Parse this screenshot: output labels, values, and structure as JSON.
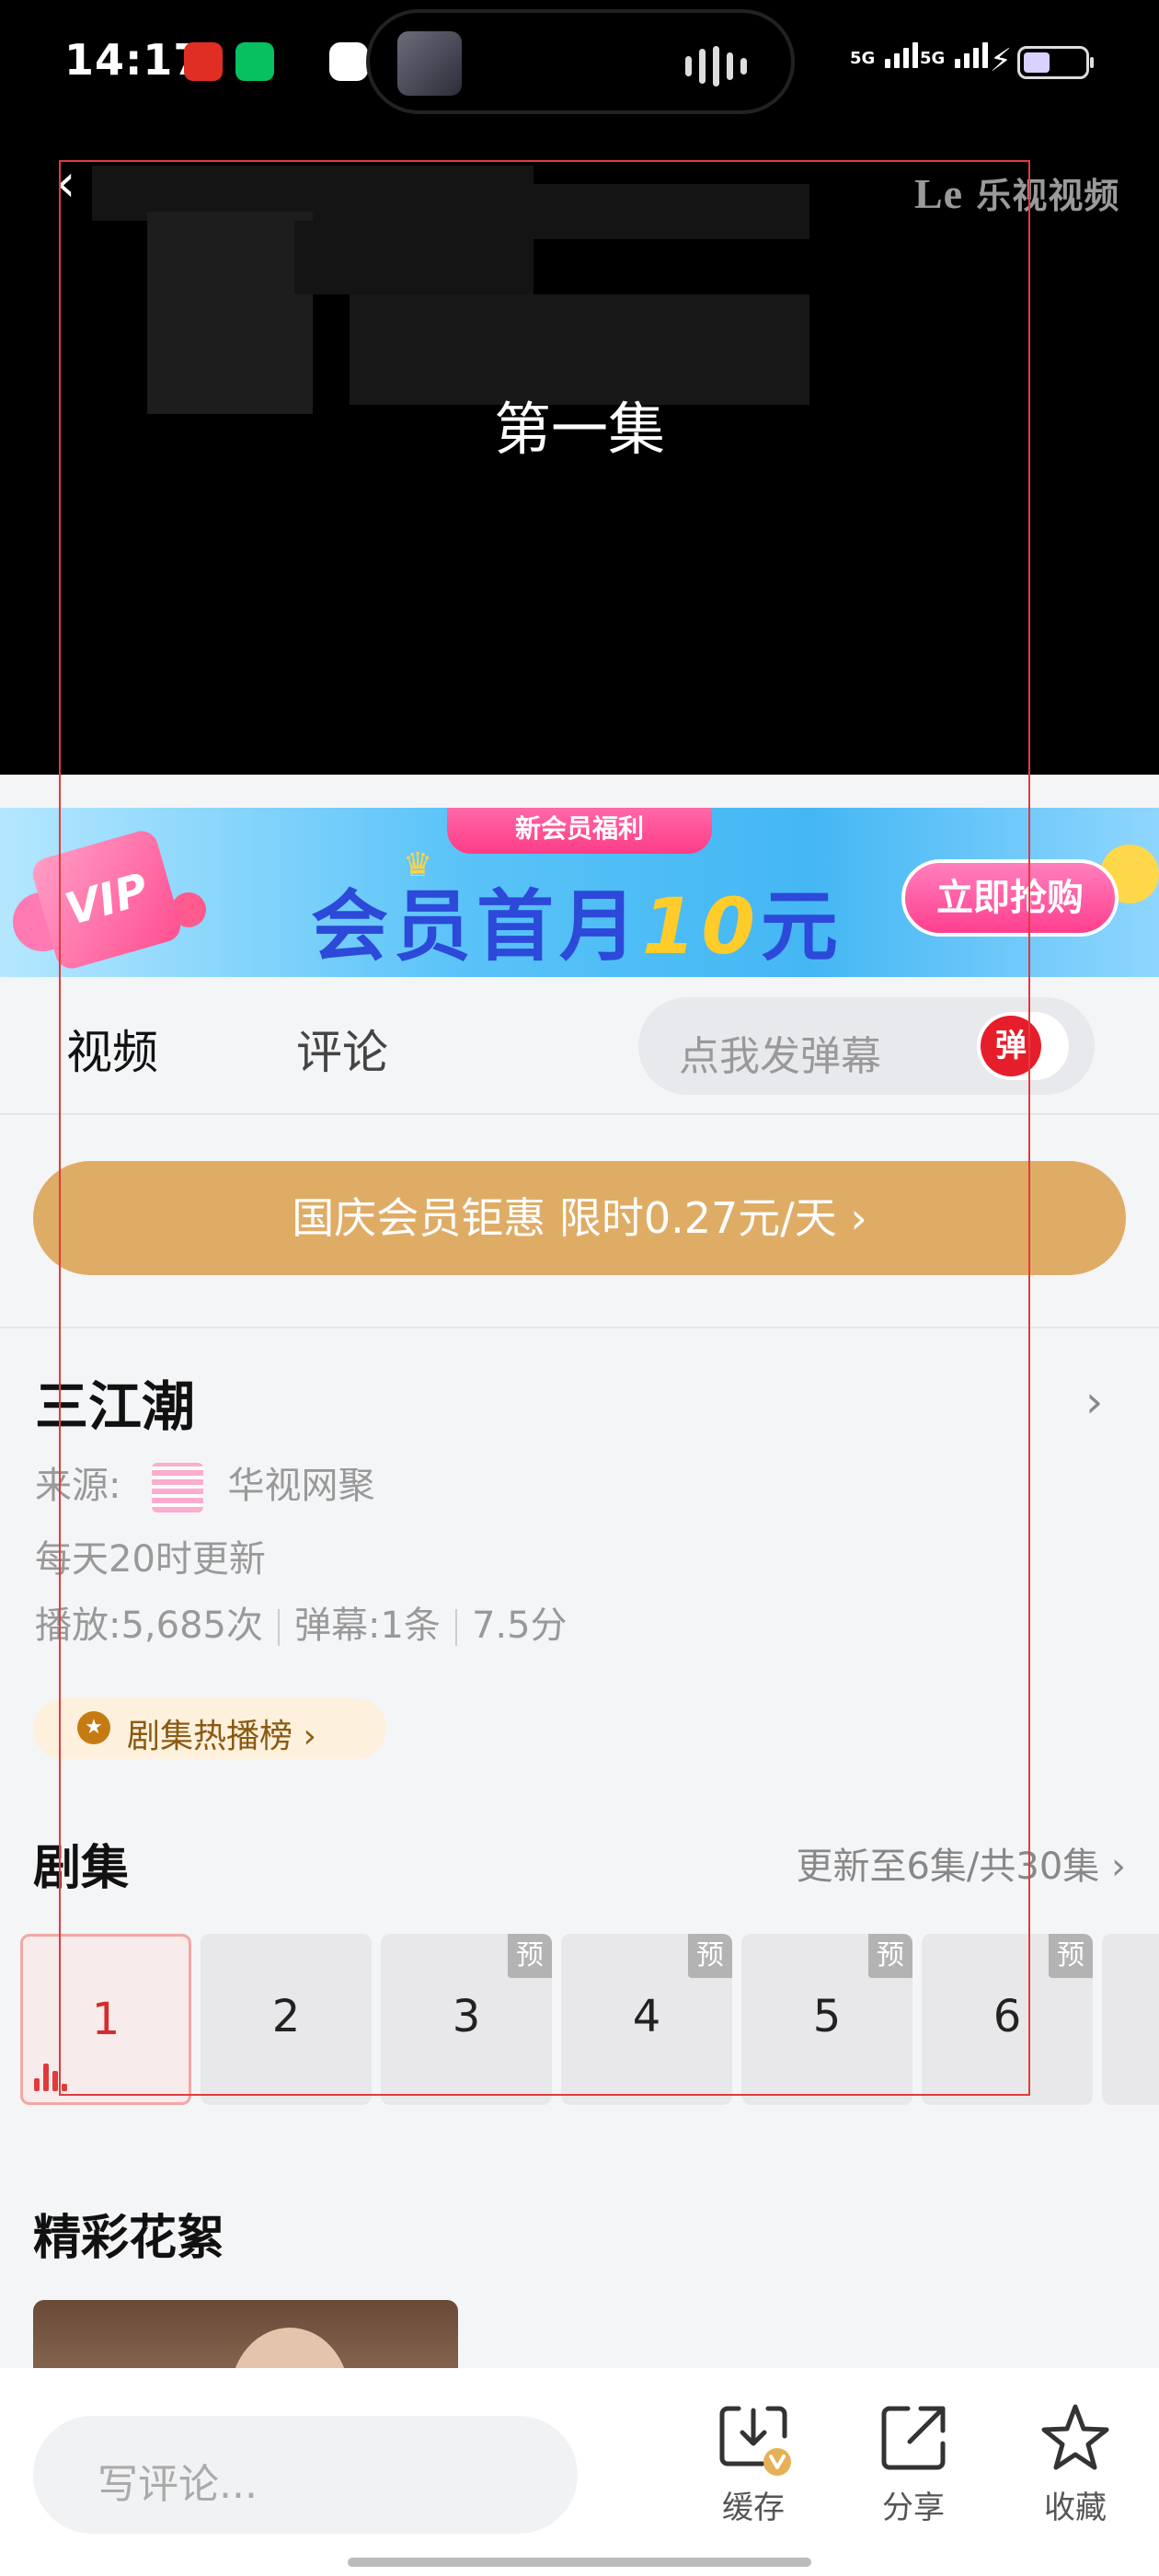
{
  "status_bar": {
    "time": "14:17",
    "network_1": "5G",
    "network_2": "5G",
    "icons": [
      "pinduoduo-icon",
      "wechat-icon",
      "qq-icon",
      "signal-icon",
      "charging-icon",
      "battery-icon"
    ]
  },
  "video": {
    "logo_prefix": "Le",
    "logo_text": "乐视视频",
    "episode_title": "第一集"
  },
  "banner": {
    "tag": "新会员福利",
    "vip_text": "VIP",
    "headline_pre": "会员首月",
    "headline_num": "10",
    "headline_post": "元",
    "button": "立即抢购"
  },
  "tabs": {
    "video": "视频",
    "comments": "评论",
    "danmaku_placeholder": "点我发弹幕",
    "danmaku_toggle": "弹"
  },
  "promo": {
    "text": "国庆会员钜惠 限时0.27元/天 ›"
  },
  "show": {
    "title": "三江潮",
    "source_label": "来源:",
    "source_name": "华视网聚",
    "schedule": "每天20时更新",
    "plays": "播放:5,685次",
    "danmaku_count": "弹幕:1条",
    "rating": "7.5分",
    "rank_chip": "剧集热播榜 ›"
  },
  "episodes": {
    "section_title": "剧集",
    "update_text": "更新至6集/共30集 ›",
    "pre_badge": "预",
    "list": [
      {
        "num": "1",
        "active": true,
        "preview": false
      },
      {
        "num": "2",
        "active": false,
        "preview": false
      },
      {
        "num": "3",
        "active": false,
        "preview": true
      },
      {
        "num": "4",
        "active": false,
        "preview": true
      },
      {
        "num": "5",
        "active": false,
        "preview": true
      },
      {
        "num": "6",
        "active": false,
        "preview": true
      }
    ]
  },
  "highlights": {
    "section_title": "精彩花絮"
  },
  "bottom_bar": {
    "comment_placeholder": "写评论...",
    "cache": "缓存",
    "share": "分享",
    "favorite": "收藏"
  },
  "colors": {
    "promo": "#dfac66",
    "active_episode": "#d72b2b",
    "danmaku_red": "#e61e2b"
  }
}
